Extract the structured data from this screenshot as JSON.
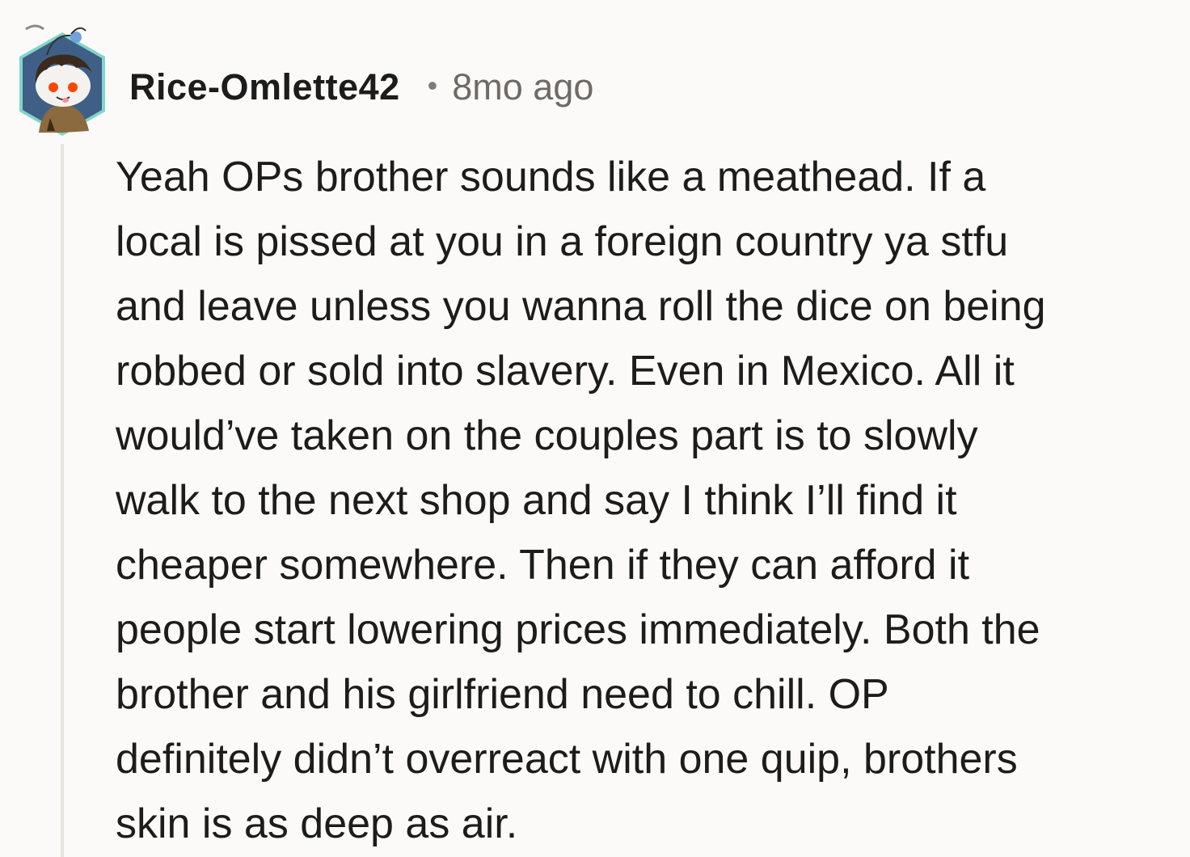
{
  "comment": {
    "author": "Rice-Omlette42",
    "separator": "•",
    "timestamp": "8mo ago",
    "body_lines": [
      "Yeah OPs brother sounds like a meathead. If a",
      "local is pissed at you in a foreign country ya stfu",
      "and leave unless you wanna roll the dice on being",
      "robbed or sold into slavery. Even in Mexico. All it",
      "would’ve taken on the couples part is to slowly",
      "walk to the next shop and say I think I’ll find it",
      "cheaper somewhere. Then if they can afford it",
      "people start lowering prices immediately. Both the",
      "brother and his girlfriend need to chill. OP",
      "definitely didn’t overreact with one quip, brothers",
      "skin is as deep as air."
    ]
  },
  "colors": {
    "background": "#fbfaf8",
    "thread_line": "#e7e3df",
    "text": "#1c1c1c",
    "meta": "#6f6a66",
    "avatar_hex": "#3f5f86"
  }
}
